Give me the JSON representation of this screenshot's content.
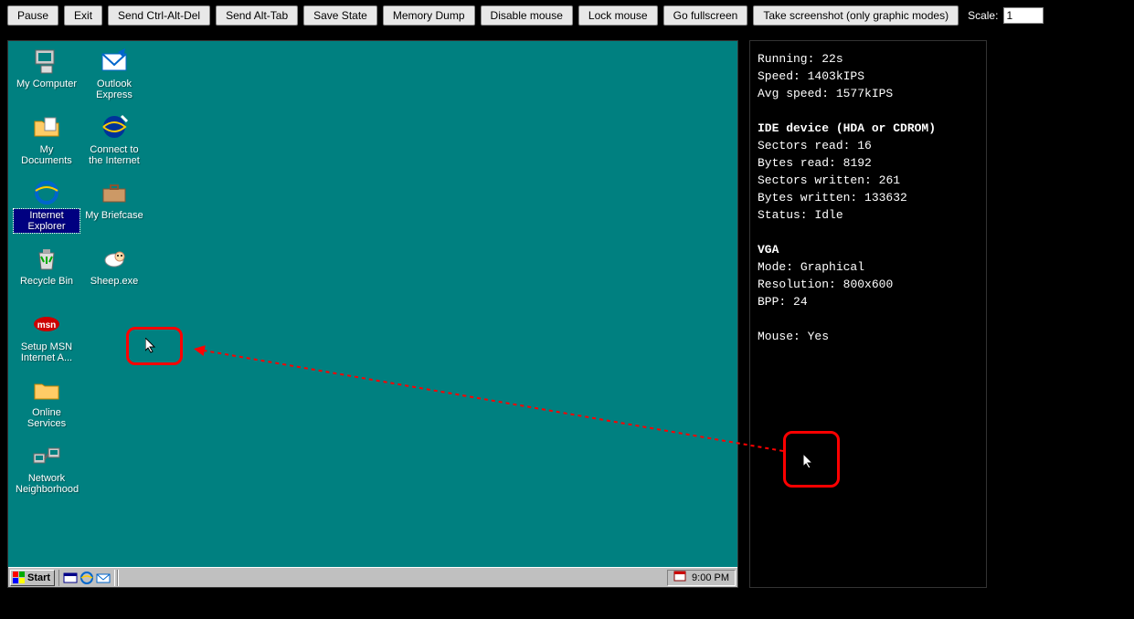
{
  "toolbar": {
    "buttons": [
      "Pause",
      "Exit",
      "Send Ctrl-Alt-Del",
      "Send Alt-Tab",
      "Save State",
      "Memory Dump",
      "Disable mouse",
      "Lock mouse",
      "Go fullscreen",
      "Take screenshot (only graphic modes)"
    ],
    "scale_label": "Scale:",
    "scale_value": "1"
  },
  "desktop": {
    "icons": [
      {
        "id": "my-computer",
        "label": "My Computer",
        "col": 0,
        "row": 0,
        "icon": "computer"
      },
      {
        "id": "outlook-express",
        "label": "Outlook Express",
        "col": 1,
        "row": 0,
        "icon": "outlook"
      },
      {
        "id": "my-documents",
        "label": "My Documents",
        "col": 0,
        "row": 1,
        "icon": "folder-doc"
      },
      {
        "id": "connect-internet",
        "label": "Connect to the Internet",
        "col": 1,
        "row": 1,
        "icon": "connect"
      },
      {
        "id": "internet-explorer",
        "label": "Internet Explorer",
        "col": 0,
        "row": 2,
        "icon": "ie",
        "selected": true
      },
      {
        "id": "my-briefcase",
        "label": "My Briefcase",
        "col": 1,
        "row": 2,
        "icon": "briefcase"
      },
      {
        "id": "recycle-bin",
        "label": "Recycle Bin",
        "col": 0,
        "row": 3,
        "icon": "recycle"
      },
      {
        "id": "sheep-exe",
        "label": "Sheep.exe",
        "col": 1,
        "row": 3,
        "icon": "sheep"
      },
      {
        "id": "setup-msn",
        "label": "Setup MSN Internet A...",
        "col": 0,
        "row": 4,
        "icon": "msn"
      },
      {
        "id": "online-services",
        "label": "Online Services",
        "col": 0,
        "row": 5,
        "icon": "folder"
      },
      {
        "id": "network-neighborhood",
        "label": "Network Neighborhood",
        "col": 0,
        "row": 6,
        "icon": "network"
      }
    ]
  },
  "taskbar": {
    "start_label": "Start",
    "quick_launch": [
      "show-desktop-icon",
      "ie-icon",
      "outlook-icon"
    ],
    "tray_icon": "scheduler-icon",
    "clock": "9:00 PM"
  },
  "status": {
    "running_label": "Running:",
    "running_value": "22s",
    "speed_label": "Speed:",
    "speed_value": "1403kIPS",
    "avgspeed_label": "Avg speed:",
    "avgspeed_value": "1577kIPS",
    "ide_header": "IDE device (HDA or CDROM)",
    "sectors_read_label": "Sectors read:",
    "sectors_read_value": "16",
    "bytes_read_label": "Bytes read:",
    "bytes_read_value": "8192",
    "sectors_written_label": "Sectors written:",
    "sectors_written_value": "261",
    "bytes_written_label": "Bytes written:",
    "bytes_written_value": "133632",
    "status_label": "Status:",
    "status_value": "Idle",
    "vga_header": "VGA",
    "mode_label": "Mode:",
    "mode_value": "Graphical",
    "resolution_label": "Resolution:",
    "resolution_value": "800x600",
    "bpp_label": "BPP:",
    "bpp_value": "24",
    "mouse_label": "Mouse:",
    "mouse_value": "Yes"
  }
}
